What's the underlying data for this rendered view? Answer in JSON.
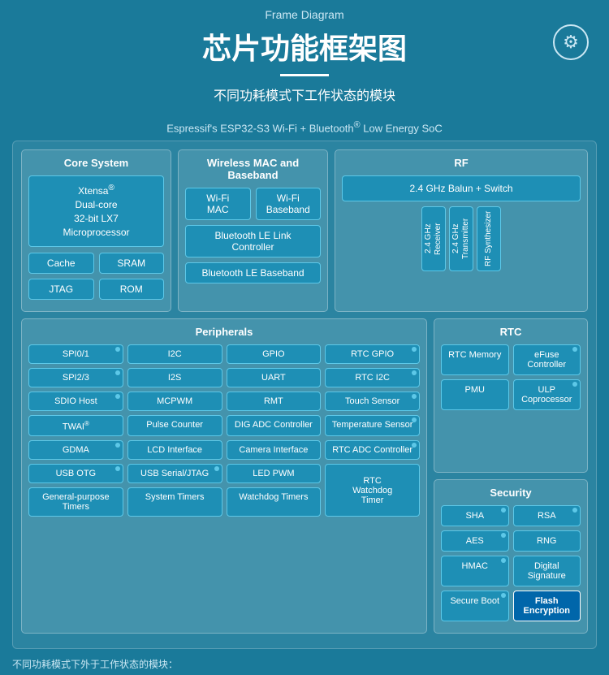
{
  "header": {
    "top_label": "Frame Diagram",
    "main_title": "芯片功能框架图",
    "subtitle": "不同功耗模式下工作状态的模块",
    "chip_label": "Espressif's ESP32-S3 Wi-Fi + Bluetooth® Low Energy SoC"
  },
  "core_system": {
    "title": "Core System",
    "processor": "Xtensa®\nDual-core\n32-bit LX7\nMicroprocessor",
    "buttons": [
      "Cache",
      "SRAM",
      "JTAG",
      "ROM"
    ]
  },
  "wireless": {
    "title": "Wireless MAC and Baseband",
    "buttons": [
      "Wi-Fi MAC",
      "Wi-Fi Baseband",
      "Bluetooth LE Link Controller",
      "Bluetooth LE Baseband"
    ]
  },
  "rf": {
    "title": "RF",
    "balun": "2.4 GHz Balun + Switch",
    "columns": [
      "2.4 GHz Receiver",
      "2.4 GHz Transmitter",
      "RF Synthesizer"
    ]
  },
  "peripherals": {
    "title": "Peripherals",
    "buttons": [
      "SPI0/1",
      "I2C",
      "GPIO",
      "RTC GPIO",
      "SPI2/3",
      "I2S",
      "UART",
      "RTC I2C",
      "SDIO Host",
      "MCPWM",
      "RMT",
      "Touch Sensor",
      "TWAI®",
      "Pulse Counter",
      "DIG ADC Controller",
      "Temperature Sensor",
      "GDMA",
      "LCD Interface",
      "Camera Interface",
      "RTC ADC Controller",
      "USB OTG",
      "USB Serial/JTAG",
      "LED PWM",
      "RTC Watchdog Timer",
      "General-purpose Timers",
      "System Timers",
      "Watchdog Timers"
    ]
  },
  "rtc": {
    "title": "RTC",
    "buttons": [
      "RTC Memory",
      "eFuse Controller",
      "PMU",
      "ULP Coprocessor"
    ]
  },
  "security": {
    "title": "Security",
    "buttons": [
      "SHA",
      "RSA",
      "AES",
      "RNG",
      "HMAC",
      "Digital Signature",
      "Secure Boot",
      "Flash Encryption"
    ]
  },
  "bottom_note": "不同功耗模式下外于工作状态的模块："
}
